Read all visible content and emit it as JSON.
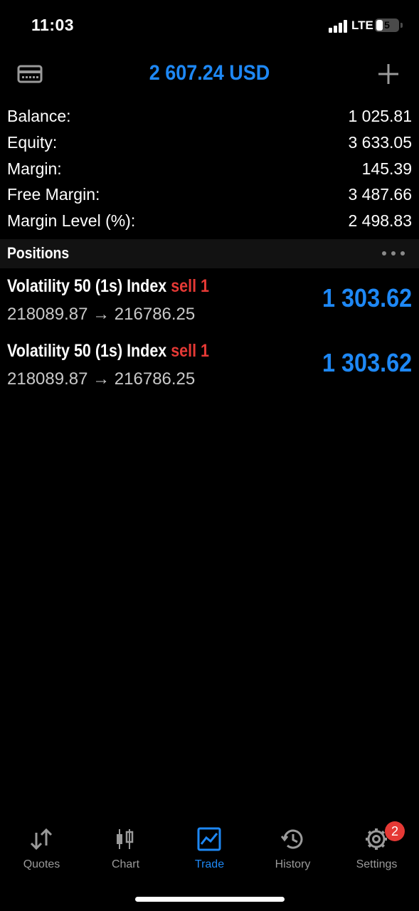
{
  "status": {
    "time": "11:03",
    "network": "LTE",
    "battery": "5"
  },
  "header": {
    "title": "2 607.24 USD",
    "left_icon": "card-icon",
    "right_icon": "plus-icon"
  },
  "account": [
    {
      "label": "Balance:",
      "value": "1 025.81"
    },
    {
      "label": "Equity:",
      "value": "3 633.05"
    },
    {
      "label": "Margin:",
      "value": "145.39"
    },
    {
      "label": "Free Margin:",
      "value": "3 487.66"
    },
    {
      "label": "Margin Level (%):",
      "value": "2 498.83"
    }
  ],
  "positions": {
    "title": "Positions",
    "items": [
      {
        "symbol": "Volatility 50 (1s) Index",
        "side": "sell 1",
        "open_price": "218089.87",
        "arrow": "→",
        "current_price": "216786.25",
        "profit": "1 303.62"
      },
      {
        "symbol": "Volatility 50 (1s) Index",
        "side": "sell 1",
        "open_price": "218089.87",
        "arrow": "→",
        "current_price": "216786.25",
        "profit": "1 303.62"
      }
    ]
  },
  "tabs": [
    {
      "label": "Quotes",
      "icon": "quotes-arrows-icon"
    },
    {
      "label": "Chart",
      "icon": "candlestick-chart-icon"
    },
    {
      "label": "Trade",
      "icon": "trade-chart-icon",
      "active": true
    },
    {
      "label": "History",
      "icon": "history-clock-icon"
    },
    {
      "label": "Settings",
      "icon": "gear-icon",
      "badge": "2"
    }
  ],
  "colors": {
    "accent": "#1e88f5",
    "sell": "#e53935",
    "background": "#000000",
    "inactive": "#9a9a9a"
  }
}
